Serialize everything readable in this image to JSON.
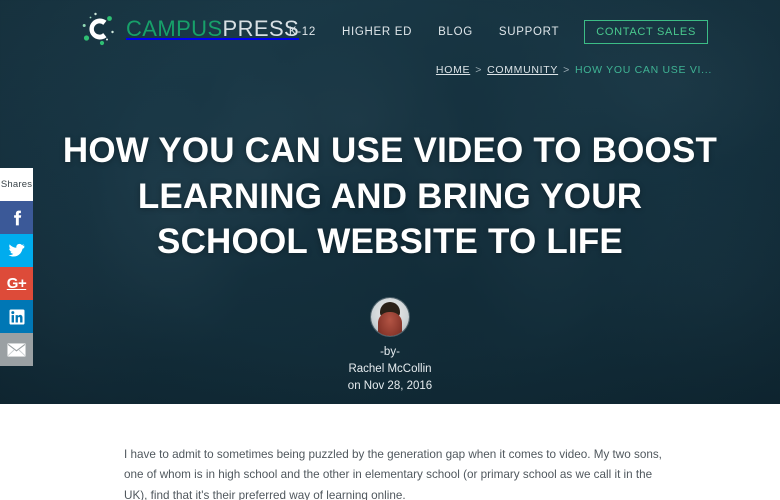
{
  "colors": {
    "brand_green": "#17a06a",
    "cta_green": "#49c98e",
    "hero_bg": "#1c3744",
    "breadcrumb_active": "#3fb394",
    "facebook": "#3b5998",
    "twitter": "#00acee",
    "google_plus": "#dd4b39",
    "linkedin": "#0077b5",
    "email": "#9aa0a3"
  },
  "header": {
    "logo": {
      "icon": "campuspress-c-logo-icon",
      "text_primary": "CAMPUS",
      "text_secondary": "PRESS"
    },
    "nav": [
      {
        "label": "K-12"
      },
      {
        "label": "HIGHER ED"
      },
      {
        "label": "BLOG"
      },
      {
        "label": "SUPPORT"
      }
    ],
    "cta": {
      "label": "CONTACT SALES"
    }
  },
  "breadcrumb": {
    "separator": ">",
    "items": [
      {
        "label": "HOME",
        "active": false
      },
      {
        "label": "COMMUNITY",
        "active": false
      },
      {
        "label": "HOW YOU CAN USE VI...",
        "active": true
      }
    ]
  },
  "hero": {
    "title": "HOW YOU CAN USE VIDEO TO BOOST LEARNING AND BRING YOUR SCHOOL WEBSITE TO LIFE",
    "background_image": "video-camera-photo"
  },
  "author": {
    "avatar": "author-avatar-image",
    "by_label": "-by-",
    "name": "Rachel McCollin",
    "date": "on Nov 28, 2016"
  },
  "share_rail": {
    "count_label": "Shares",
    "buttons": [
      {
        "name": "facebook",
        "icon": "facebook-icon"
      },
      {
        "name": "twitter",
        "icon": "twitter-icon"
      },
      {
        "name": "google-plus",
        "icon": "google-plus-icon",
        "glyph": "G+"
      },
      {
        "name": "linkedin",
        "icon": "linkedin-icon",
        "glyph": "in"
      },
      {
        "name": "email",
        "icon": "email-icon"
      }
    ]
  },
  "article": {
    "paragraph": "I have to admit to sometimes being puzzled by the generation gap when it comes to video. My two sons, one of whom is in high school and the other in elementary school (or primary school as we call it in the UK), find that it's their preferred way of learning online."
  }
}
